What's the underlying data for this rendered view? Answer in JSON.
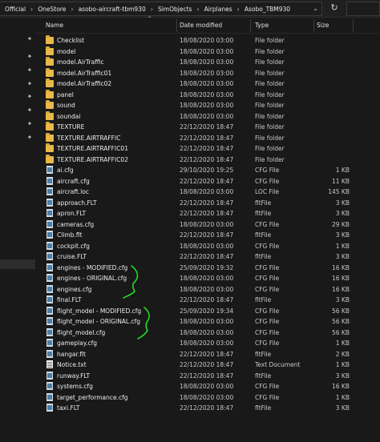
{
  "breadcrumb": [
    "Official",
    "OneStore",
    "asobo-aircraft-tbm930",
    "SimObjects",
    "Airplanes",
    "Asobo_TBM930"
  ],
  "columns": {
    "name": "Name",
    "date": "Date modified",
    "type": "Type",
    "size": "Size"
  },
  "rows": [
    {
      "name": "Checklist",
      "date": "18/08/2020 03:00",
      "type": "File folder",
      "size": "",
      "icon": "folder"
    },
    {
      "name": "model",
      "date": "18/08/2020 03:00",
      "type": "File folder",
      "size": "",
      "icon": "folder"
    },
    {
      "name": "model.AirTraffic",
      "date": "18/08/2020 03:00",
      "type": "File folder",
      "size": "",
      "icon": "folder"
    },
    {
      "name": "model.AirTraffic01",
      "date": "18/08/2020 03:00",
      "type": "File folder",
      "size": "",
      "icon": "folder"
    },
    {
      "name": "model.AirTraffic02",
      "date": "18/08/2020 03:00",
      "type": "File folder",
      "size": "",
      "icon": "folder"
    },
    {
      "name": "panel",
      "date": "18/08/2020 03:00",
      "type": "File folder",
      "size": "",
      "icon": "folder"
    },
    {
      "name": "sound",
      "date": "18/08/2020 03:00",
      "type": "File folder",
      "size": "",
      "icon": "folder"
    },
    {
      "name": "soundai",
      "date": "18/08/2020 03:00",
      "type": "File folder",
      "size": "",
      "icon": "folder"
    },
    {
      "name": "TEXTURE",
      "date": "22/12/2020 18:47",
      "type": "File folder",
      "size": "",
      "icon": "folder"
    },
    {
      "name": "TEXTURE.AIRTRAFFIC",
      "date": "22/12/2020 18:47",
      "type": "File folder",
      "size": "",
      "icon": "folder"
    },
    {
      "name": "TEXTURE.AIRTRAFFIC01",
      "date": "22/12/2020 18:47",
      "type": "File folder",
      "size": "",
      "icon": "folder"
    },
    {
      "name": "TEXTURE.AIRTRAFFIC02",
      "date": "22/12/2020 18:47",
      "type": "File folder",
      "size": "",
      "icon": "folder"
    },
    {
      "name": "ai.cfg",
      "date": "29/10/2020 19:25",
      "type": "CFG File",
      "size": "1 KB",
      "icon": "file"
    },
    {
      "name": "aircraft.cfg",
      "date": "22/12/2020 18:47",
      "type": "CFG File",
      "size": "11 KB",
      "icon": "file"
    },
    {
      "name": "aircraft.loc",
      "date": "18/08/2020 03:00",
      "type": "LOC File",
      "size": "145 KB",
      "icon": "file"
    },
    {
      "name": "approach.FLT",
      "date": "22/12/2020 18:47",
      "type": "fltFile",
      "size": "3 KB",
      "icon": "file"
    },
    {
      "name": "apron.FLT",
      "date": "22/12/2020 18:47",
      "type": "fltFile",
      "size": "3 KB",
      "icon": "file"
    },
    {
      "name": "cameras.cfg",
      "date": "18/08/2020 03:00",
      "type": "CFG File",
      "size": "29 KB",
      "icon": "file"
    },
    {
      "name": "Climb.flt",
      "date": "22/12/2020 18:47",
      "type": "fltFile",
      "size": "3 KB",
      "icon": "file"
    },
    {
      "name": "cockpit.cfg",
      "date": "18/08/2020 03:00",
      "type": "CFG File",
      "size": "1 KB",
      "icon": "file"
    },
    {
      "name": "cruise.FLT",
      "date": "22/12/2020 18:47",
      "type": "fltFile",
      "size": "3 KB",
      "icon": "file"
    },
    {
      "name": "engines - MODIFIED.cfg",
      "date": "25/09/2020 19:32",
      "type": "CFG File",
      "size": "16 KB",
      "icon": "file"
    },
    {
      "name": "engines - ORIGINAL.cfg",
      "date": "18/08/2020 03:00",
      "type": "CFG File",
      "size": "16 KB",
      "icon": "file"
    },
    {
      "name": "engines.cfg",
      "date": "18/08/2020 03:00",
      "type": "CFG File",
      "size": "16 KB",
      "icon": "file"
    },
    {
      "name": "final.FLT",
      "date": "22/12/2020 18:47",
      "type": "fltFile",
      "size": "3 KB",
      "icon": "file"
    },
    {
      "name": "flight_model - MODIFIED.cfg",
      "date": "25/09/2020 19:34",
      "type": "CFG File",
      "size": "56 KB",
      "icon": "file"
    },
    {
      "name": "flight_model - ORIGINAL.cfg",
      "date": "18/08/2020 03:00",
      "type": "CFG File",
      "size": "56 KB",
      "icon": "file"
    },
    {
      "name": "flight_model.cfg",
      "date": "18/08/2020 03:00",
      "type": "CFG File",
      "size": "56 KB",
      "icon": "file"
    },
    {
      "name": "gameplay.cfg",
      "date": "18/08/2020 03:00",
      "type": "CFG File",
      "size": "1 KB",
      "icon": "file"
    },
    {
      "name": "hangar.flt",
      "date": "22/12/2020 18:47",
      "type": "fltFile",
      "size": "2 KB",
      "icon": "file"
    },
    {
      "name": "Notice.txt",
      "date": "22/12/2020 18:47",
      "type": "Text Document",
      "size": "1 KB",
      "icon": "txt"
    },
    {
      "name": "runway.FLT",
      "date": "22/12/2020 18:47",
      "type": "fltFile",
      "size": "3 KB",
      "icon": "file"
    },
    {
      "name": "systems.cfg",
      "date": "18/08/2020 03:00",
      "type": "CFG File",
      "size": "16 KB",
      "icon": "file"
    },
    {
      "name": "target_performance.cfg",
      "date": "18/08/2020 03:00",
      "type": "CFG File",
      "size": "1 KB",
      "icon": "file"
    },
    {
      "name": "taxi.FLT",
      "date": "22/12/2020 18:47",
      "type": "fltFile",
      "size": "3 KB",
      "icon": "file"
    }
  ],
  "colors": {
    "annotation": "#22dd22",
    "folder": "#e8b948"
  }
}
